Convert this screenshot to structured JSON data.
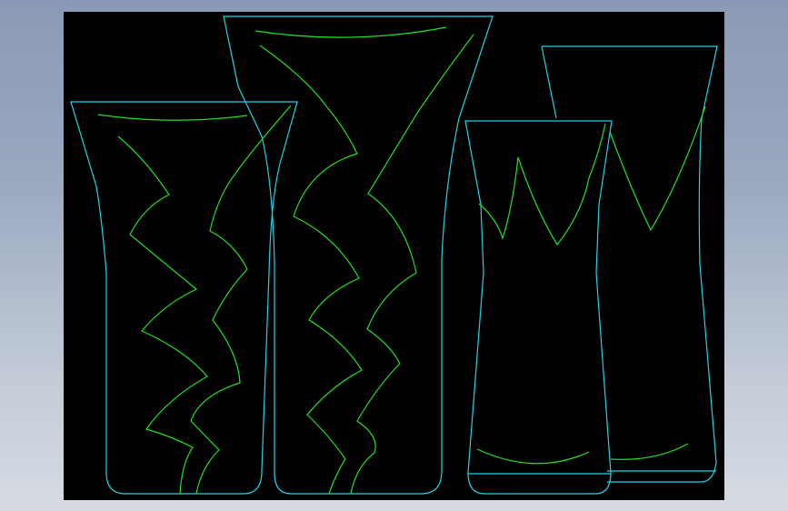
{
  "drawing": {
    "background_color": "#000000",
    "outline_color": "#22d3e6",
    "pattern_color": "#22e022",
    "objects": [
      "vase-1",
      "vase-2",
      "vase-3",
      "vase-4"
    ]
  }
}
